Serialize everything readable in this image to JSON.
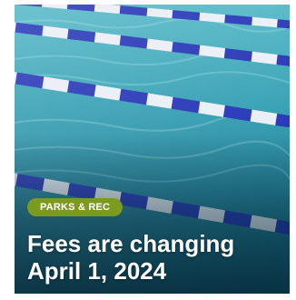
{
  "card": {
    "badge_label": "PARKS & REC",
    "headline_line1": "Fees are changing",
    "headline_line2": "April 1, 2024",
    "image_subject": "swimming pool lane lines",
    "badge_color": "#7c9a1f",
    "lane_rope_colors": [
      "#1f2fb5",
      "#e9eef5"
    ]
  }
}
